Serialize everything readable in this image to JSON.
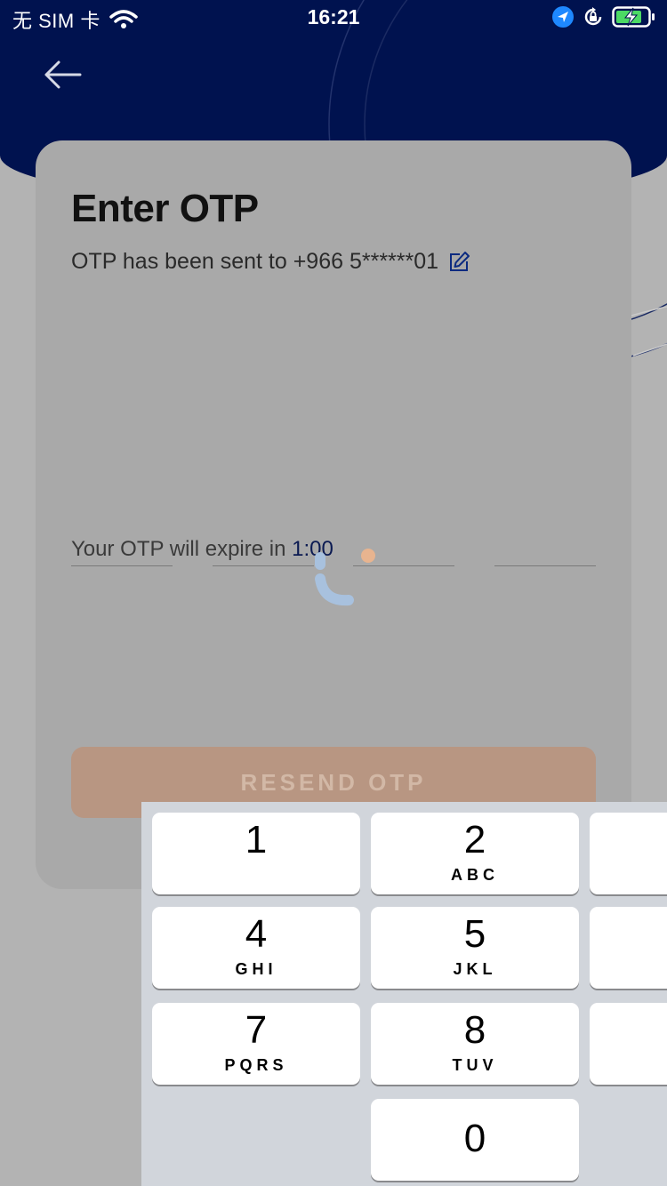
{
  "status_bar": {
    "carrier": "无 SIM 卡",
    "time": "16:21"
  },
  "colors": {
    "header_background": "#00124f",
    "accent": "#0b1a52",
    "resend_button": "#b89682"
  },
  "header": {
    "back_icon": "arrow-left-icon"
  },
  "otp_card": {
    "title": "Enter OTP",
    "subtitle": "OTP has been sent to +966 5******01",
    "edit_icon": "pencil-edit-icon",
    "digits": [
      "",
      "",
      "",
      ""
    ],
    "expiry_label": "Your OTP will expire in",
    "expiry_time": "1:00",
    "resend_label": "RESEND OTP"
  },
  "keypad": {
    "keys": [
      {
        "num": "1",
        "letters": ""
      },
      {
        "num": "2",
        "letters": "ABC"
      },
      {
        "num": "4",
        "letters": "GHI"
      },
      {
        "num": "5",
        "letters": "JKL"
      },
      {
        "num": "7",
        "letters": "PQRS"
      },
      {
        "num": "8",
        "letters": "TUV"
      },
      {
        "num": "0",
        "letters": ""
      }
    ]
  }
}
